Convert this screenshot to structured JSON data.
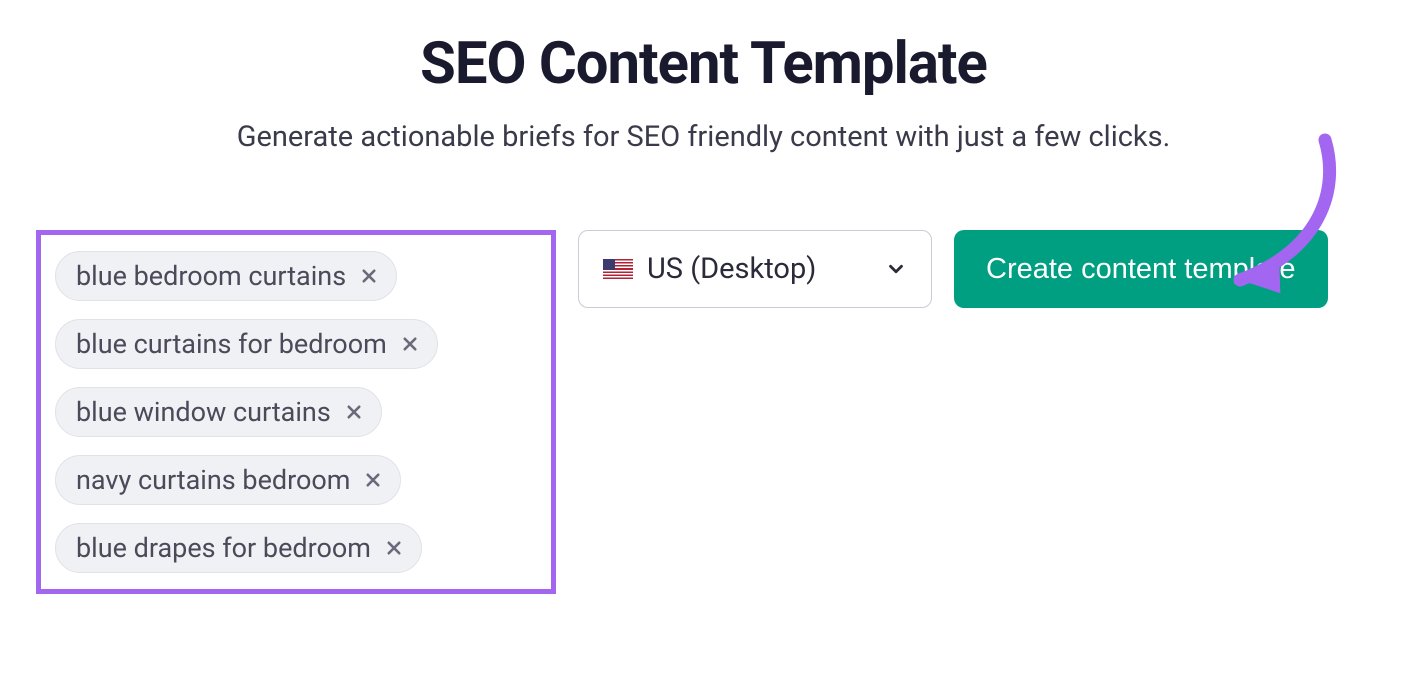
{
  "header": {
    "title": "SEO Content Template",
    "subtitle": "Generate actionable briefs for SEO friendly content with just a few clicks."
  },
  "keywords": [
    "blue bedroom curtains",
    "blue curtains for bedroom",
    "blue window curtains",
    "navy curtains bedroom",
    "blue drapes for bedroom"
  ],
  "locale": {
    "flag": "us",
    "label": "US (Desktop)"
  },
  "actions": {
    "create_label": "Create content template"
  },
  "colors": {
    "highlight_border": "#a266f0",
    "primary_button": "#009f81",
    "annotation_arrow": "#a266f0"
  }
}
